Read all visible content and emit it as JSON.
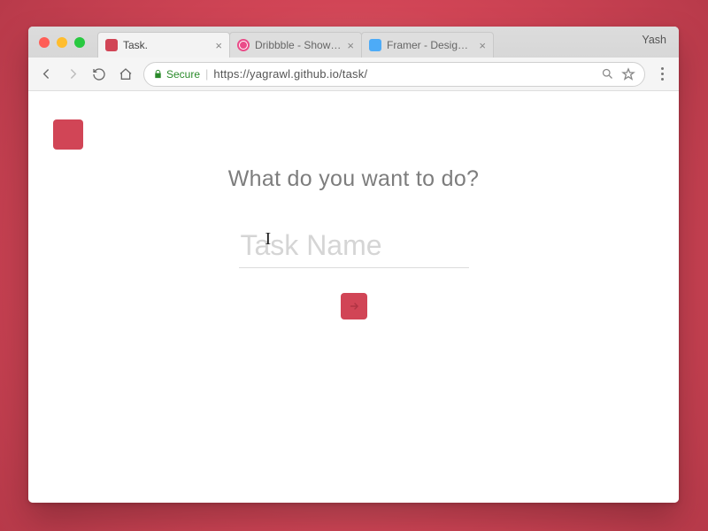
{
  "window": {
    "profile_name": "Yash"
  },
  "tabs": [
    {
      "title": "Task.",
      "active": true
    },
    {
      "title": "Dribbble - Show and t",
      "active": false
    },
    {
      "title": "Framer - Design, code",
      "active": false
    }
  ],
  "toolbar": {
    "secure_label": "Secure",
    "url": "https://yagrawl.github.io/task/"
  },
  "page": {
    "prompt": "What do you want to do?",
    "input_placeholder": "Task Name",
    "input_value": ""
  },
  "colors": {
    "accent": "#d14556"
  }
}
